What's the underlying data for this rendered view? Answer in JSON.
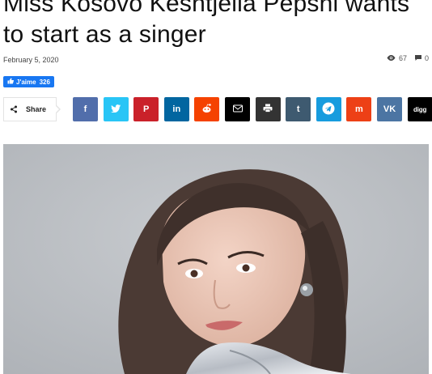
{
  "article": {
    "title": "Miss Kosovo Keshtjella Pepshi wants to start as a singer",
    "date": "February 5, 2020",
    "views": "67",
    "comments": "0"
  },
  "facebook": {
    "like_label": "J'aime",
    "like_count": "326"
  },
  "share": {
    "label": "Share",
    "buttons": [
      {
        "name": "facebook",
        "glyph": "f",
        "color": "#516eab"
      },
      {
        "name": "twitter",
        "glyph": "",
        "color": "#29c5f6"
      },
      {
        "name": "pinterest",
        "glyph": "P",
        "color": "#ca212a"
      },
      {
        "name": "linkedin",
        "glyph": "in",
        "color": "#0266a0"
      },
      {
        "name": "reddit",
        "glyph": "",
        "color": "#f54200"
      },
      {
        "name": "email",
        "glyph": "",
        "color": "#000000"
      },
      {
        "name": "print",
        "glyph": "",
        "color": "#333333"
      },
      {
        "name": "tumblr",
        "glyph": "t",
        "color": "#3e5a70"
      },
      {
        "name": "telegram",
        "glyph": "",
        "color": "#179cde"
      },
      {
        "name": "mix",
        "glyph": "m",
        "color": "#ed4016"
      },
      {
        "name": "vk",
        "glyph": "VK",
        "color": "#4c75a3"
      },
      {
        "name": "digg",
        "glyph": "digg",
        "color": "#000000"
      }
    ]
  },
  "icons": {
    "views": "eye-icon",
    "comments": "comment-icon",
    "share": "share-icon",
    "like": "thumbs-up-icon"
  }
}
